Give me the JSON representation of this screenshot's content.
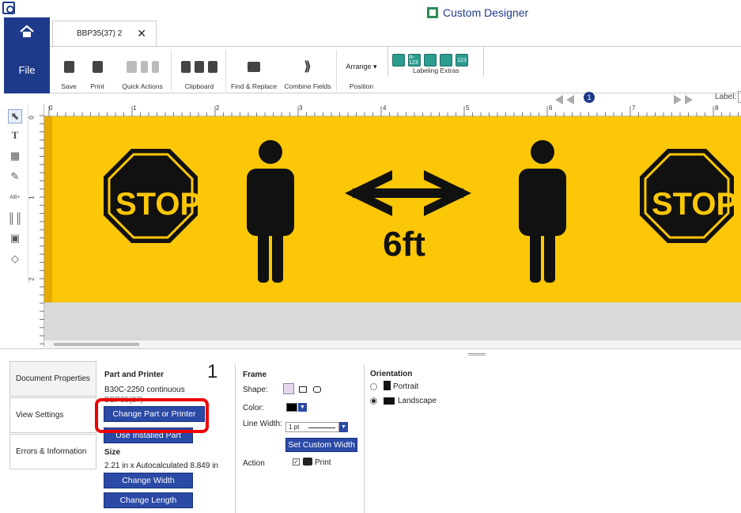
{
  "window": {
    "title": "Custom Designer"
  },
  "tabs": {
    "document": "BBP35(37) 2",
    "close": "✕"
  },
  "ribbon": {
    "file": "File",
    "save": "Save",
    "print": "Print",
    "quick_actions": "Quick Actions",
    "clipboard": "Clipboard",
    "find_replace": "Find & Replace",
    "combine_fields": "Combine Fields",
    "arrange": "Arrange ▾",
    "position": "Position",
    "labeling_extras": "Labeling Extras",
    "extra_icons": [
      "",
      "A-123",
      "",
      "",
      "123"
    ]
  },
  "navigation": {
    "page": "1",
    "label": "Label:"
  },
  "ruler": {
    "h": [
      "0",
      "1",
      "2",
      "3",
      "4",
      "5",
      "6",
      "7",
      "8"
    ],
    "v": [
      "0",
      "1",
      "2"
    ]
  },
  "canvas": {
    "stop_left": "STOP",
    "distance": "6ft",
    "stop_right": "STOP",
    "background": "#fbc707"
  },
  "side_tabs": [
    "Document Properties",
    "View Settings",
    "Errors & Information"
  ],
  "callout": "1",
  "part_printer": {
    "title": "Part and Printer",
    "printer": "B30C-2250 continuous",
    "part": "BBP35(37)",
    "change_part_btn": "Change Part or Printer",
    "use_installed_btn": "Use Installed Part"
  },
  "size": {
    "title": "Size",
    "value": "2.21 in x Autocalculated 8.849 in",
    "change_width_btn": "Change Width",
    "change_length_btn": "Change Length"
  },
  "frame": {
    "title": "Frame",
    "shape_label": "Shape:",
    "color_label": "Color:",
    "line_width_label": "Line Width:",
    "line_width_value": "1 pt",
    "custom_width_btn": "Set Custom Width",
    "action_label": "Action",
    "print_option": "Print"
  },
  "orientation": {
    "title": "Orientation",
    "portrait": "Portrait",
    "landscape": "Landscape",
    "selected": "Landscape"
  },
  "colors": {
    "brand": "#1e3a8a",
    "button": "#2b4aa6",
    "highlight": "#e00000"
  }
}
